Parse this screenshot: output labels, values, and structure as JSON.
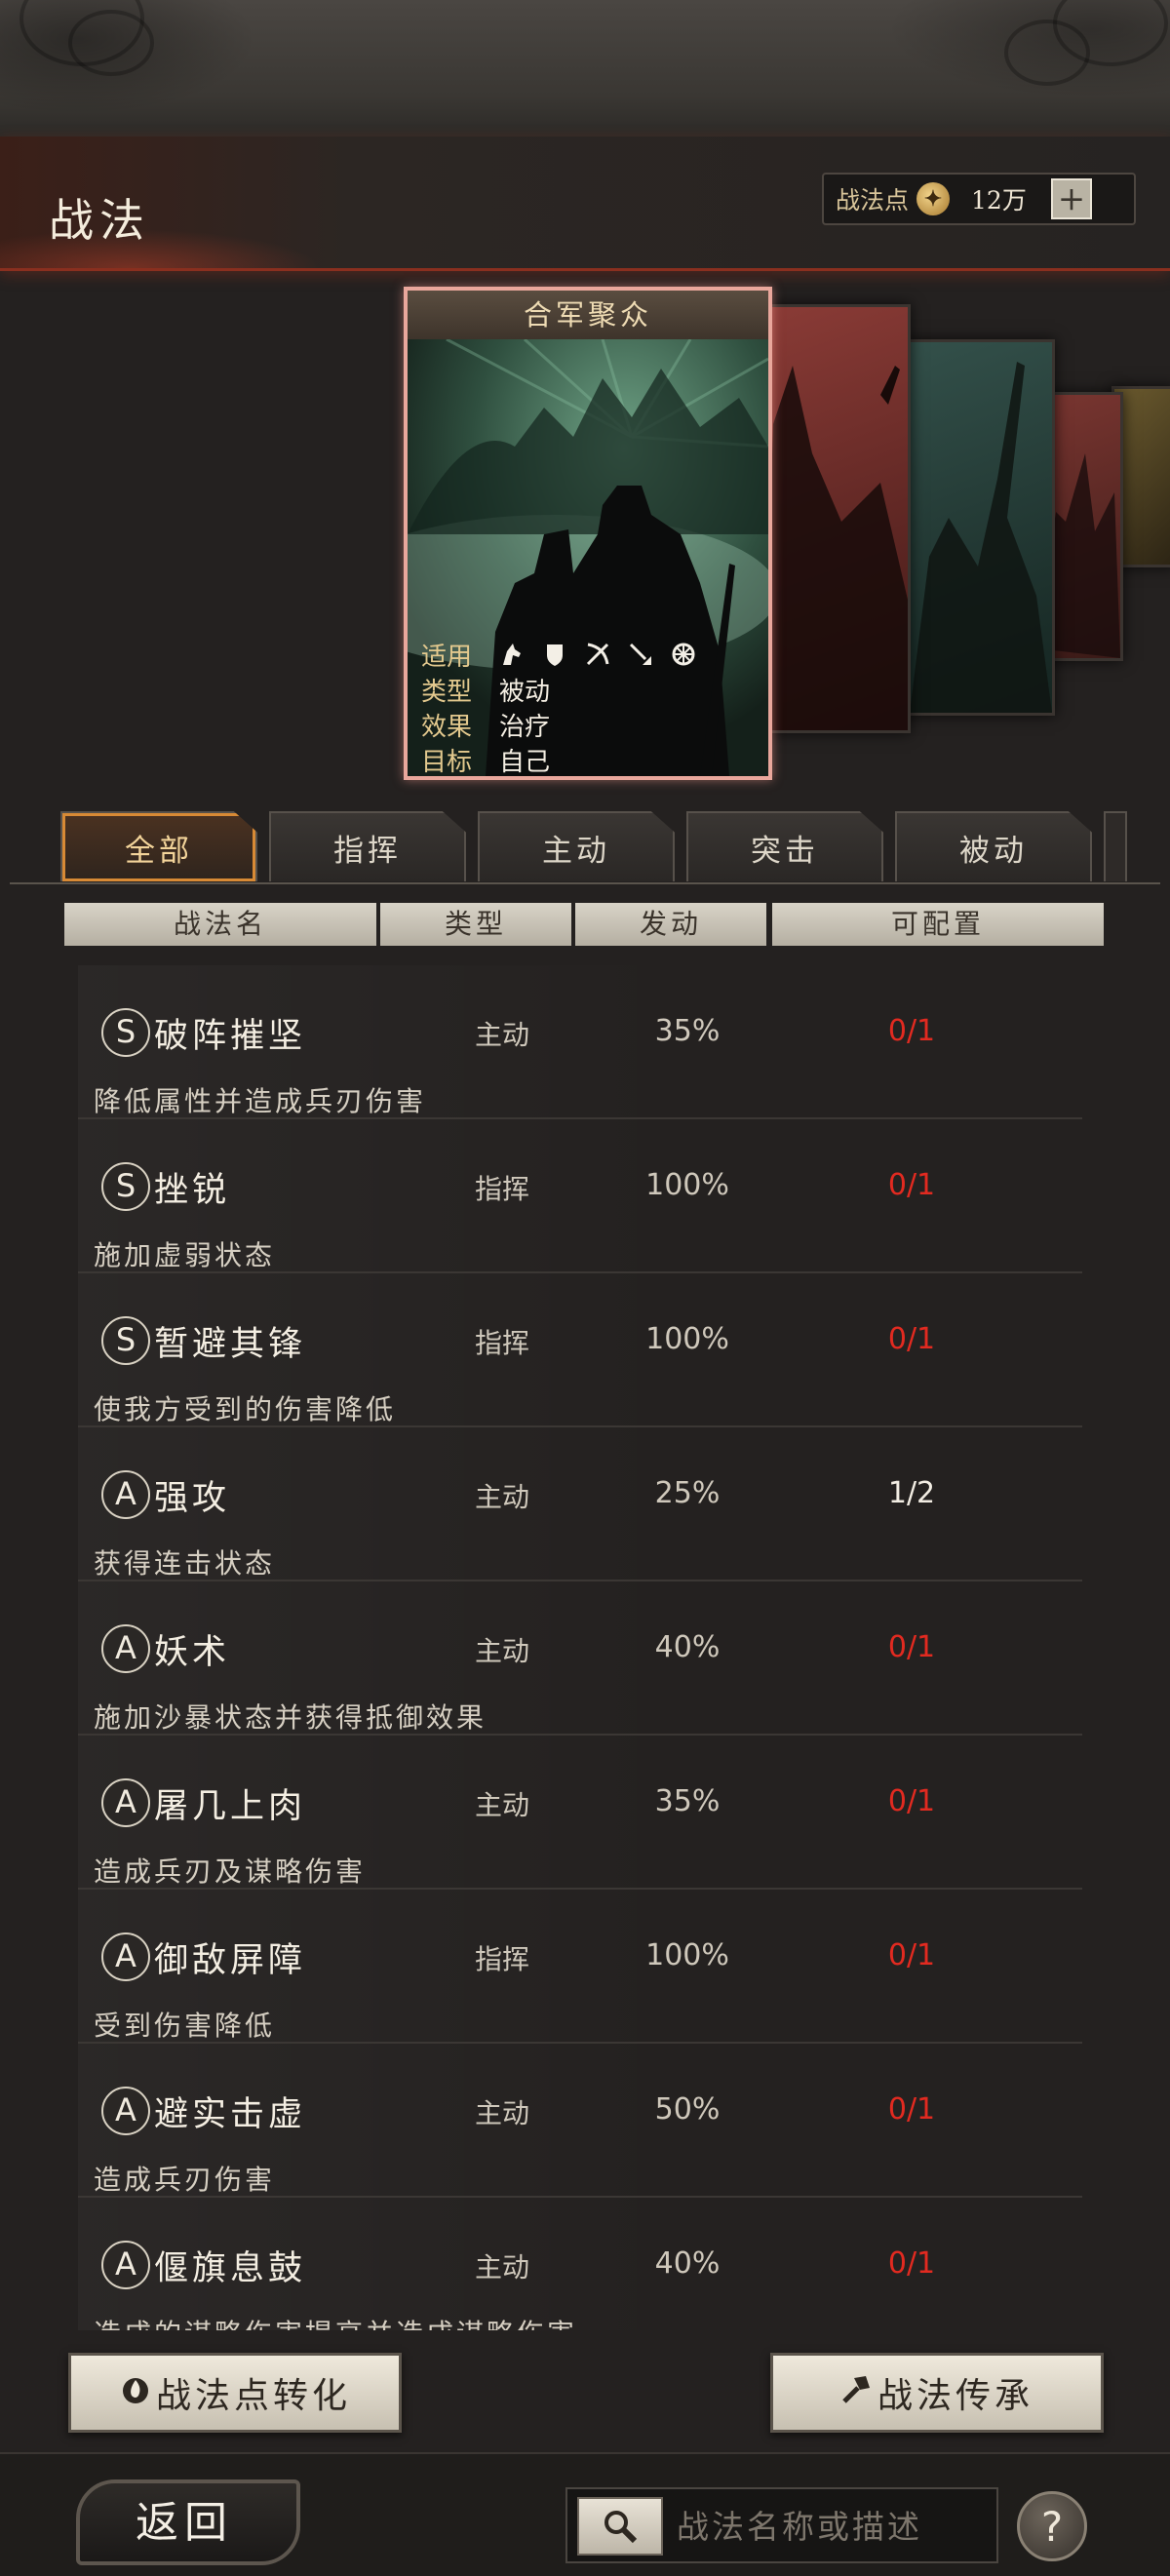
{
  "header": {
    "title": "战法",
    "points_label": "战法点",
    "points_value": "12万",
    "plus_label": "+"
  },
  "featured_card": {
    "name": "合军聚众",
    "rows": [
      {
        "key": "适用",
        "value": ""
      },
      {
        "key": "类型",
        "value": "被动"
      },
      {
        "key": "效果",
        "value": "治疗"
      },
      {
        "key": "目标",
        "value": "自己"
      }
    ],
    "range_icons": [
      "cavalry-icon",
      "shield-icon",
      "bow-icon",
      "spear-icon",
      "wheel-icon"
    ]
  },
  "tabs": [
    "全部",
    "指挥",
    "主动",
    "突击",
    "被动"
  ],
  "active_tab": "全部",
  "columns": [
    "战法名",
    "类型",
    "发动",
    "可配置"
  ],
  "skills": [
    {
      "grade": "S",
      "name": "破阵摧坚",
      "type": "主动",
      "rate": "35%",
      "config": "0/1",
      "desc": "降低属性并造成兵刃伤害"
    },
    {
      "grade": "S",
      "name": "挫锐",
      "type": "指挥",
      "rate": "100%",
      "config": "0/1",
      "desc": "施加虚弱状态"
    },
    {
      "grade": "S",
      "name": "暂避其锋",
      "type": "指挥",
      "rate": "100%",
      "config": "0/1",
      "desc": "使我方受到的伤害降低"
    },
    {
      "grade": "A",
      "name": "强攻",
      "type": "主动",
      "rate": "25%",
      "config": "1/2",
      "desc": "获得连击状态"
    },
    {
      "grade": "A",
      "name": "妖术",
      "type": "主动",
      "rate": "40%",
      "config": "0/1",
      "desc": "施加沙暴状态并获得抵御效果"
    },
    {
      "grade": "A",
      "name": "屠几上肉",
      "type": "主动",
      "rate": "35%",
      "config": "0/1",
      "desc": "造成兵刃及谋略伤害"
    },
    {
      "grade": "A",
      "name": "御敌屏障",
      "type": "指挥",
      "rate": "100%",
      "config": "0/1",
      "desc": "受到伤害降低"
    },
    {
      "grade": "A",
      "name": "避实击虚",
      "type": "主动",
      "rate": "50%",
      "config": "0/1",
      "desc": "造成兵刃伤害"
    },
    {
      "grade": "A",
      "name": "偃旗息鼓",
      "type": "主动",
      "rate": "40%",
      "config": "0/1",
      "desc": "造成的谋略伤害提高并造成谋略伤害"
    }
  ],
  "buttons": {
    "convert": "战法点转化",
    "inherit": "战法传承",
    "back": "返回",
    "help": "?"
  },
  "search": {
    "placeholder": "战法名称或描述"
  },
  "colors": {
    "config_unavailable": "#e22a20",
    "config_available": "#f2ede3",
    "active_tab_border": "#d88a35",
    "card_border": "#e9a79c"
  }
}
